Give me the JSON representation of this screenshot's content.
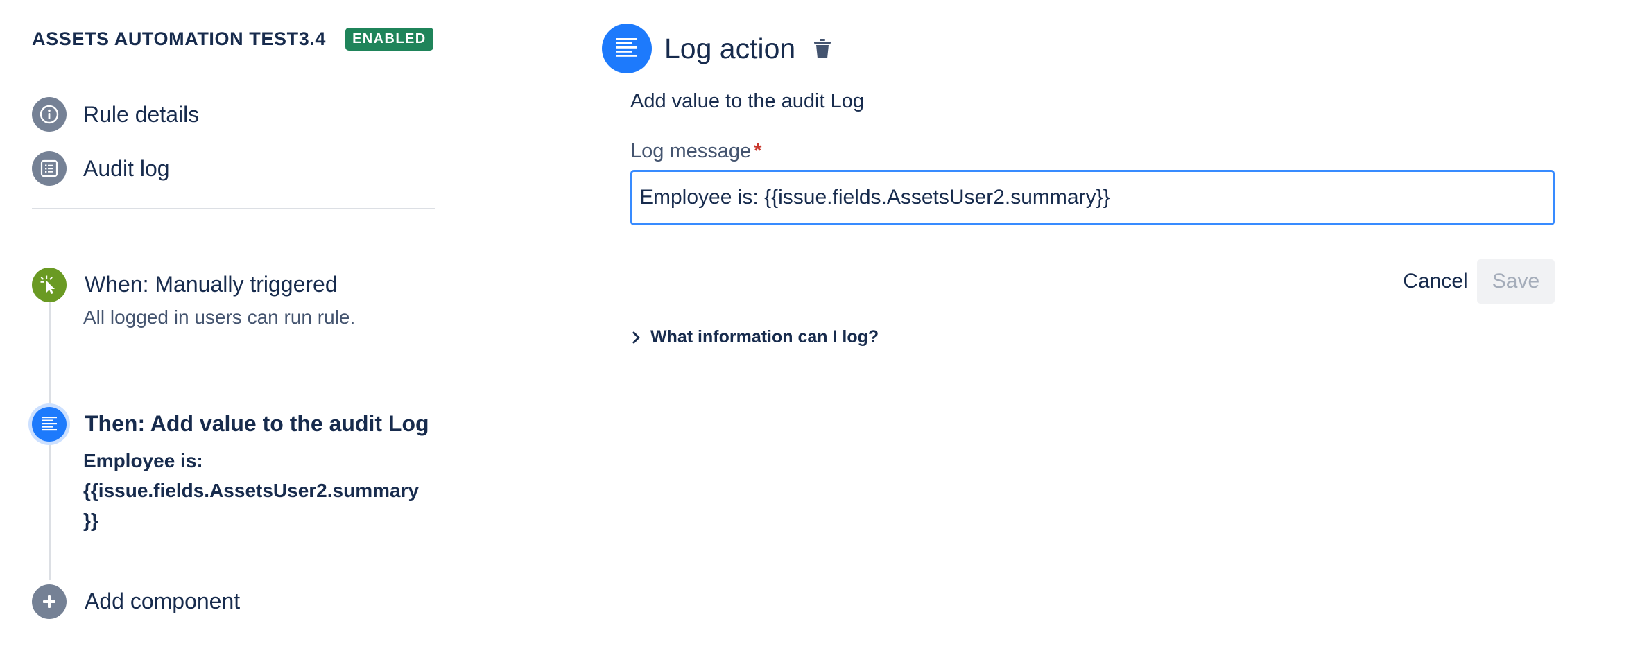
{
  "rule": {
    "name": "ASSETS AUTOMATION TEST3.4",
    "status": "ENABLED"
  },
  "nav": {
    "rule_details": "Rule details",
    "audit_log": "Audit log"
  },
  "steps": {
    "trigger": {
      "title": "When: Manually triggered",
      "subtitle": "All logged in users can run rule."
    },
    "action": {
      "title": "Then: Add value to the audit Log",
      "desc_line1": "Employee is:",
      "desc_line2": "{{issue.fields.AssetsUser2.summary",
      "desc_line3": "}}"
    },
    "add": {
      "title": "Add component"
    }
  },
  "panel": {
    "title": "Log action",
    "description": "Add value to the audit Log",
    "field_label": "Log message",
    "required_mark": "*",
    "field_value": "Employee is: {{issue.fields.AssetsUser2.summary}}",
    "cancel_label": "Cancel",
    "save_label": "Save",
    "help_label": "What information can I log?"
  },
  "colors": {
    "enabled_badge": "#1f845a",
    "trigger_green": "#6a9a23",
    "action_blue": "#1d7afc",
    "neutral_icon": "#758195",
    "focus_border": "#388bff"
  },
  "icons": {
    "rule_details": "info-icon",
    "audit_log": "list-icon",
    "trigger": "cursor-click-icon",
    "action": "log-lines-icon",
    "add": "plus-icon",
    "delete": "trash-icon",
    "expand": "chevron-right-icon"
  }
}
